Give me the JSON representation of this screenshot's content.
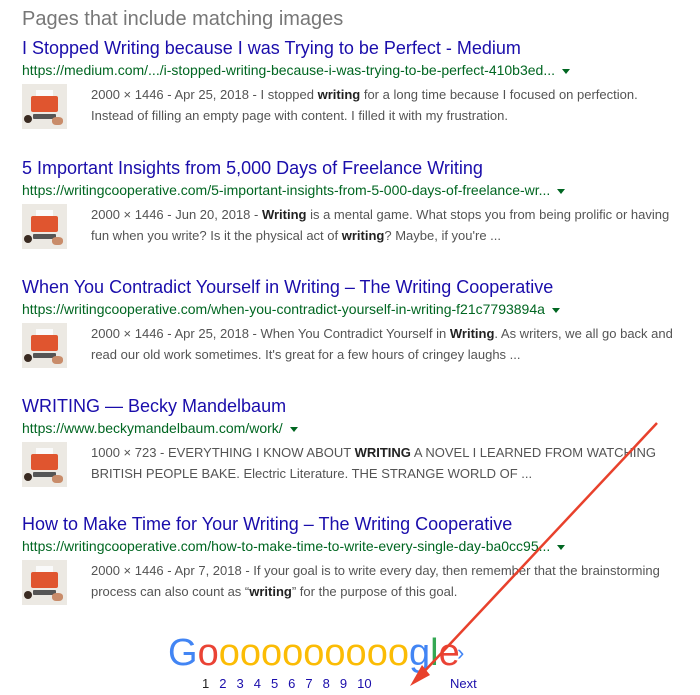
{
  "heading": "Pages that include matching images",
  "results": [
    {
      "title": "I Stopped Writing because I was Trying to be Perfect - Medium",
      "url": "https://medium.com/.../i-stopped-writing-because-i-was-trying-to-be-perfect-410b3ed...",
      "meta": "2000 × 1446 - Apr 25, 2018 - ",
      "snippet": [
        {
          "t": "I stopped ",
          "b": false
        },
        {
          "t": "writing",
          "b": true
        },
        {
          "t": " for a long time because I focused on perfection. Instead of filling an empty page with content. I filled it with my frustration.",
          "b": false
        }
      ]
    },
    {
      "title": "5 Important Insights from 5,000 Days of Freelance Writing",
      "url": "https://writingcooperative.com/5-important-insights-from-5-000-days-of-freelance-wr...",
      "meta": "2000 × 1446 - Jun 20, 2018 - ",
      "snippet": [
        {
          "t": "Writing",
          "b": true
        },
        {
          "t": " is a mental game. What stops you from being prolific or having fun when you write? Is it the physical act of ",
          "b": false
        },
        {
          "t": "writing",
          "b": true
        },
        {
          "t": "? Maybe, if you're ...",
          "b": false
        }
      ]
    },
    {
      "title": "When You Contradict Yourself in Writing – The Writing Cooperative",
      "url": "https://writingcooperative.com/when-you-contradict-yourself-in-writing-f21c7793894a",
      "meta": "2000 × 1446 - Apr 25, 2018 - ",
      "snippet": [
        {
          "t": "When You Contradict Yourself in ",
          "b": false
        },
        {
          "t": "Writing",
          "b": true
        },
        {
          "t": ". As writers, we all go back and read our old work sometimes. It's great for a few hours of cringey laughs ...",
          "b": false
        }
      ]
    },
    {
      "title": "WRITING — Becky Mandelbaum",
      "url": "https://www.beckymandelbaum.com/work/",
      "meta": "1000 × 723 - ",
      "snippet": [
        {
          "t": "EVERYTHING I KNOW ABOUT ",
          "b": false
        },
        {
          "t": "WRITING",
          "b": true
        },
        {
          "t": " A NOVEL I LEARNED FROM WATCHING BRITISH PEOPLE BAKE. Electric Literature. THE STRANGE WORLD OF ...",
          "b": false
        }
      ]
    },
    {
      "title": "How to Make Time for Your Writing – The Writing Cooperative",
      "url": "https://writingcooperative.com/how-to-make-time-to-write-every-single-day-ba0cc95...",
      "meta": "2000 × 1446 - Apr 7, 2018 - ",
      "snippet": [
        {
          "t": "If your goal is to write every day, then remember that the brainstorming process can also count as “",
          "b": false
        },
        {
          "t": "writing",
          "b": true
        },
        {
          "t": "” for the purpose of this goal.",
          "b": false
        }
      ]
    }
  ],
  "pagination": {
    "logo_letters": [
      {
        "ch": "G",
        "color": "#4285f4"
      },
      {
        "ch": "o",
        "color": "#ea4335"
      },
      {
        "ch": "o",
        "color": "#fbbc05"
      },
      {
        "ch": "o",
        "color": "#fbbc05"
      },
      {
        "ch": "o",
        "color": "#fbbc05"
      },
      {
        "ch": "o",
        "color": "#fbbc05"
      },
      {
        "ch": "o",
        "color": "#fbbc05"
      },
      {
        "ch": "o",
        "color": "#fbbc05"
      },
      {
        "ch": "o",
        "color": "#fbbc05"
      },
      {
        "ch": "o",
        "color": "#fbbc05"
      },
      {
        "ch": "o",
        "color": "#fbbc05"
      },
      {
        "ch": "g",
        "color": "#4285f4"
      },
      {
        "ch": "l",
        "color": "#34a853"
      },
      {
        "ch": "e",
        "color": "#ea4335"
      }
    ],
    "current": "1",
    "pages": [
      "2",
      "3",
      "4",
      "5",
      "6",
      "7",
      "8",
      "9",
      "10"
    ],
    "next_label": "Next",
    "next_icon": "chevron-right-icon"
  },
  "annotation": {
    "type": "red-arrow",
    "color": "#e8412c"
  }
}
